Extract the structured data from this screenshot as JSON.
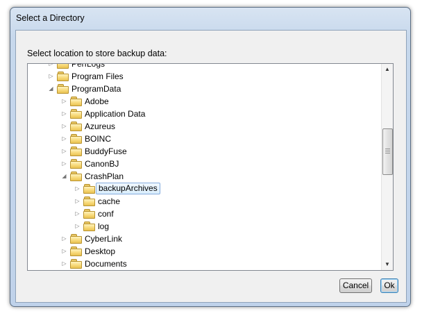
{
  "window": {
    "title": "Select a Directory"
  },
  "dialog": {
    "prompt": "Select location to store backup data:"
  },
  "tree": {
    "items": [
      {
        "label": "PerfLogs",
        "expander": "collapsed",
        "depth": 0
      },
      {
        "label": "Program Files",
        "expander": "collapsed",
        "depth": 0
      },
      {
        "label": "ProgramData",
        "expander": "expanded",
        "depth": 0
      },
      {
        "label": "Adobe",
        "expander": "collapsed",
        "depth": 1
      },
      {
        "label": "Application Data",
        "expander": "collapsed",
        "depth": 1
      },
      {
        "label": "Azureus",
        "expander": "collapsed",
        "depth": 1
      },
      {
        "label": "BOINC",
        "expander": "collapsed",
        "depth": 1
      },
      {
        "label": "BuddyFuse",
        "expander": "collapsed",
        "depth": 1
      },
      {
        "label": "CanonBJ",
        "expander": "collapsed",
        "depth": 1
      },
      {
        "label": "CrashPlan",
        "expander": "expanded",
        "depth": 1
      },
      {
        "label": "backupArchives",
        "expander": "collapsed",
        "depth": 2,
        "selected": true
      },
      {
        "label": "cache",
        "expander": "collapsed",
        "depth": 2
      },
      {
        "label": "conf",
        "expander": "collapsed",
        "depth": 2
      },
      {
        "label": "log",
        "expander": "collapsed",
        "depth": 2
      },
      {
        "label": "CyberLink",
        "expander": "collapsed",
        "depth": 1
      },
      {
        "label": "Desktop",
        "expander": "collapsed",
        "depth": 1
      },
      {
        "label": "Documents",
        "expander": "collapsed",
        "depth": 1
      }
    ]
  },
  "buttons": {
    "cancel": "Cancel",
    "ok": "Ok"
  },
  "icons": {
    "folder": "folder-icon",
    "expander_collapsed": "▷",
    "expander_expanded": "◢",
    "scroll_up": "▲",
    "scroll_down": "▼"
  },
  "colors": {
    "selection_border": "#84acdd",
    "selection_fill": "#d9edfc",
    "folder": "#f6d774"
  }
}
